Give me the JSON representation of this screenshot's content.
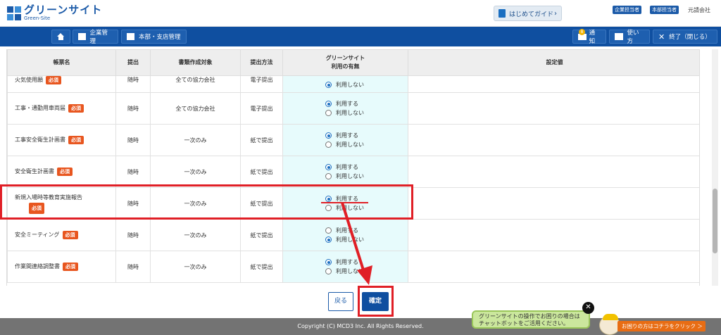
{
  "header": {
    "logo_main": "グリーンサイト",
    "logo_sub": "Green-Site",
    "guide_label": "はじめてガイド",
    "roles": [
      "企業担当者",
      "本部担当者"
    ],
    "company": "元請会社"
  },
  "nav": {
    "home": "",
    "company_mgmt": "企業管理",
    "branch_mgmt": "本部・支店管理",
    "notice": "通知",
    "notice_count": "8",
    "howto": "使い方",
    "exit": "終了（閉じる）"
  },
  "table": {
    "headers": {
      "name": "帳票名",
      "submit": "提出",
      "target": "書類作成対象",
      "method": "提出方法",
      "gs_line1": "グリーンサイト",
      "gs_line2": "利用の有無",
      "setting": "設定値"
    },
    "use": "利用する",
    "not_use": "利用しない",
    "required": "必須",
    "rows": [
      {
        "name": "火気使用願",
        "submit": "随時",
        "target": "全ての協力会社",
        "method": "電子提出",
        "selected": "not_use"
      },
      {
        "name": "工事・通勤用車両届",
        "submit": "随時",
        "target": "全ての協力会社",
        "method": "電子提出",
        "selected": "use"
      },
      {
        "name": "工事安全衛生計画書",
        "submit": "随時",
        "target": "一次のみ",
        "method": "紙で提出",
        "selected": "use"
      },
      {
        "name": "安全衛生計画書",
        "submit": "随時",
        "target": "一次のみ",
        "method": "紙で提出",
        "selected": "use"
      },
      {
        "name": "新規入場時等教育実施報告",
        "submit": "随時",
        "target": "一次のみ",
        "method": "紙で提出",
        "selected": "use"
      },
      {
        "name": "安全ミーティング",
        "submit": "随時",
        "target": "一次のみ",
        "method": "紙で提出",
        "selected": "not_use"
      },
      {
        "name": "作業間連絡調整書",
        "submit": "随時",
        "target": "一次のみ",
        "method": "紙で提出",
        "selected": "use"
      }
    ]
  },
  "buttons": {
    "back": "戻る",
    "confirm": "確定"
  },
  "footer": {
    "copyright": "Copyright (C) MCD3 Inc. All Rights Reserved."
  },
  "chat": {
    "bubble_line1": "グリーンサイトの操作でお困りの場合は",
    "bubble_line2": "チャットボットをご活用ください。",
    "close": "✕",
    "link": "お困りの方はコチラをクリック ＞"
  },
  "colors": {
    "brand": "#0f4fa0",
    "required": "#e8561f",
    "annotation": "#e01f26",
    "gs_column": "#e7fbfc"
  }
}
